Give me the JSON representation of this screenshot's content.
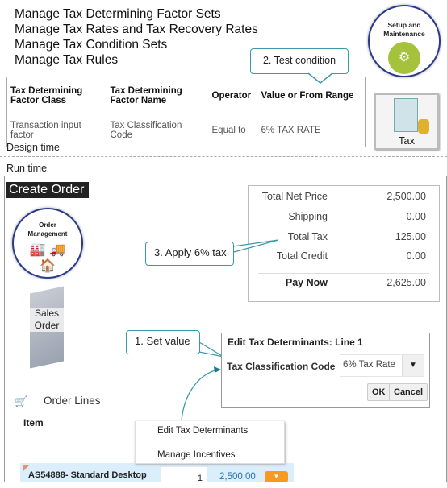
{
  "design": {
    "tasks": [
      "Manage Tax Determining Factor Sets",
      "Manage Tax Rates and Tax Recovery Rates",
      "Manage Tax Condition Sets",
      "Manage Tax Rules"
    ],
    "setup_icon_label": "Setup and Maintenance",
    "tax_icon_label": "Tax",
    "callout_test": "2. Test condition",
    "table": {
      "headers": [
        "Tax Determining Factor Class",
        "Tax Determining Factor Name",
        "Operator",
        "Value or From Range"
      ],
      "rows": [
        [
          "Transaction input factor",
          "Tax Classification Code",
          "Equal to",
          "6% TAX RATE"
        ]
      ]
    },
    "label": "Design time"
  },
  "run": {
    "label": "Run time",
    "title": "Create Order",
    "om_icon_label": "Order Management",
    "sales_order_label": "Sales Order",
    "totals": [
      {
        "label": "Total Net Price",
        "value": "2,500.00"
      },
      {
        "label": "Shipping",
        "value": "0.00"
      },
      {
        "label": "Total Tax",
        "value": "125.00"
      },
      {
        "label": "Total Credit",
        "value": "0.00"
      },
      {
        "label": "Pay Now",
        "value": "2,625.00"
      }
    ],
    "callout_apply": "3. Apply 6% tax",
    "callout_set": "1. Set value",
    "dialog": {
      "title": "Edit Tax Determinants: Line 1",
      "field_label": "Tax Classification Code",
      "field_value": "6% Tax Rate",
      "ok": "OK",
      "cancel": "Cancel"
    },
    "order_lines": "Order Lines",
    "item_header": "Item",
    "menu": [
      "Edit Tax Determinants",
      "Manage Incentives"
    ],
    "line": {
      "item": "AS54888- Standard Desktop",
      "qty": "1",
      "amount": "2,500.00"
    }
  },
  "colors": {
    "accent": "#3a9aa8",
    "circle_border": "#2b3a8c",
    "gear_green": "#a4c23c",
    "orange": "#f79a1f",
    "link_blue": "#2a6fb0",
    "row_bg": "#dbeefc"
  }
}
